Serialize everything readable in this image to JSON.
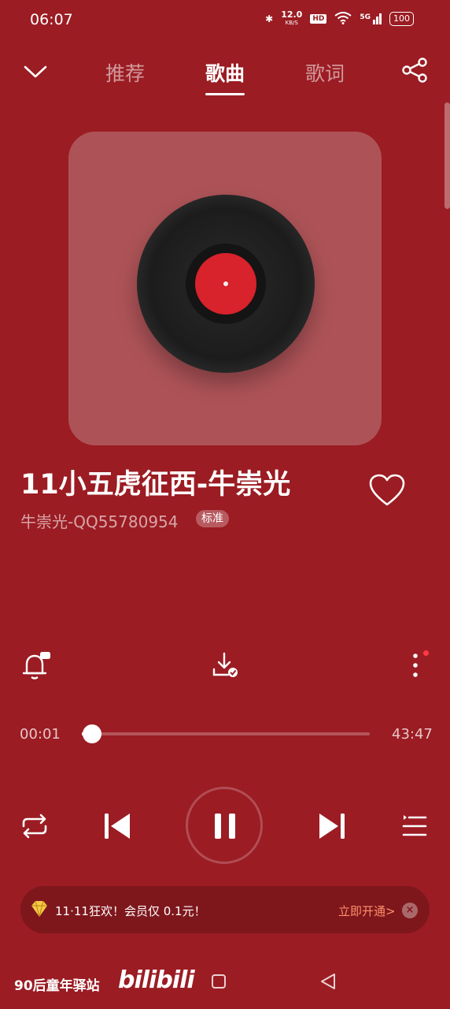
{
  "status_bar": {
    "time": "06:07",
    "net_speed_top": "12.0",
    "net_speed_bottom": "KB/S",
    "hd": "HD",
    "signal": "5G",
    "battery": "100"
  },
  "tabs": [
    {
      "label": "推荐",
      "active": false
    },
    {
      "label": "歌曲",
      "active": true
    },
    {
      "label": "歌词",
      "active": false
    }
  ],
  "song": {
    "title": "11小五虎征西-牛崇光",
    "artist": "牛崇光-QQ55780954",
    "quality_badge": "标准"
  },
  "player": {
    "current_time": "00:01",
    "total_time": "43:47",
    "progress": 0.0004
  },
  "banner": {
    "promo_text": "11·11狂欢！会员仅 0.1元！",
    "cta": "立即开通>",
    "close": "×"
  },
  "watermark": {
    "channel": "90后童年驿站",
    "logo_text": "bilibili"
  },
  "colors": {
    "background": "#9b1c23",
    "cover_bg": "#ad5357",
    "record_label": "#d8222c",
    "cta": "#ff8f6a"
  },
  "icons": [
    "chevron-down-icon",
    "share-icon",
    "bell-icon",
    "download-icon",
    "more-icon",
    "repeat-icon",
    "previous-icon",
    "pause-icon",
    "next-icon",
    "playlist-icon",
    "vip-diamond-icon",
    "home-icon",
    "back-icon"
  ]
}
